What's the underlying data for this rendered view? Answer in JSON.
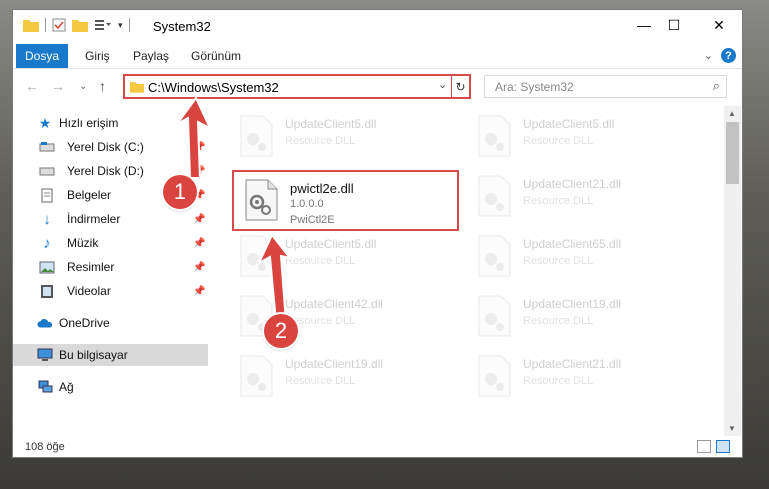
{
  "window": {
    "title": "System32",
    "minimize_glyph": "—",
    "maximize_glyph": "☐",
    "close_glyph": "✕"
  },
  "ribbon": {
    "file_tab": "Dosya",
    "tabs": [
      "Giriş",
      "Paylaş",
      "Görünüm"
    ]
  },
  "nav": {
    "address": "C:\\Windows\\System32",
    "search_placeholder": "Ara: System32"
  },
  "sidebar": {
    "quick_access": "Hızlı erişim",
    "items": [
      {
        "label": "Yerel Disk (C:)",
        "icon": "drive-icon"
      },
      {
        "label": "Yerel Disk (D:)",
        "icon": "drive-icon"
      },
      {
        "label": "Belgeler",
        "icon": "documents-icon"
      },
      {
        "label": "İndirmeler",
        "icon": "download-icon"
      },
      {
        "label": "Müzik",
        "icon": "music-icon"
      },
      {
        "label": "Resimler",
        "icon": "pictures-icon"
      },
      {
        "label": "Videolar",
        "icon": "videos-icon"
      }
    ],
    "onedrive": "OneDrive",
    "this_pc": "Bu bilgisayar",
    "network": "Ağ"
  },
  "files": {
    "highlighted": {
      "name": "pwictl2e.dll",
      "version": "1.0.0.0",
      "description": "PwiCtl2E"
    },
    "background_left": [
      {
        "name": "UpdateClient5.dll",
        "type": "Resource DLL"
      },
      {
        "name": "UpdateClient5.dll",
        "type": "Resource DLL"
      },
      {
        "name": "UpdateClient42.dll",
        "type": "Resource DLL"
      },
      {
        "name": "UpdateClient19.dll",
        "type": "Resource DLL"
      }
    ],
    "background_right": [
      {
        "name": "UpdateClient5.dll",
        "type": "Resource DLL"
      },
      {
        "name": "UpdateClient21.dll",
        "type": "Resource DLL"
      },
      {
        "name": "UpdateClient65.dll",
        "type": "Resource DLL"
      },
      {
        "name": "UpdateClient19.dll",
        "type": "Resource DLL"
      },
      {
        "name": "UpdateClient21.dll",
        "type": "Resource DLL"
      }
    ]
  },
  "status": {
    "item_count": "108 öğe"
  },
  "callouts": {
    "first": "1",
    "second": "2"
  },
  "colors": {
    "accent": "#1979ca",
    "highlight": "#d94b4b",
    "callout": "#d9443f"
  }
}
